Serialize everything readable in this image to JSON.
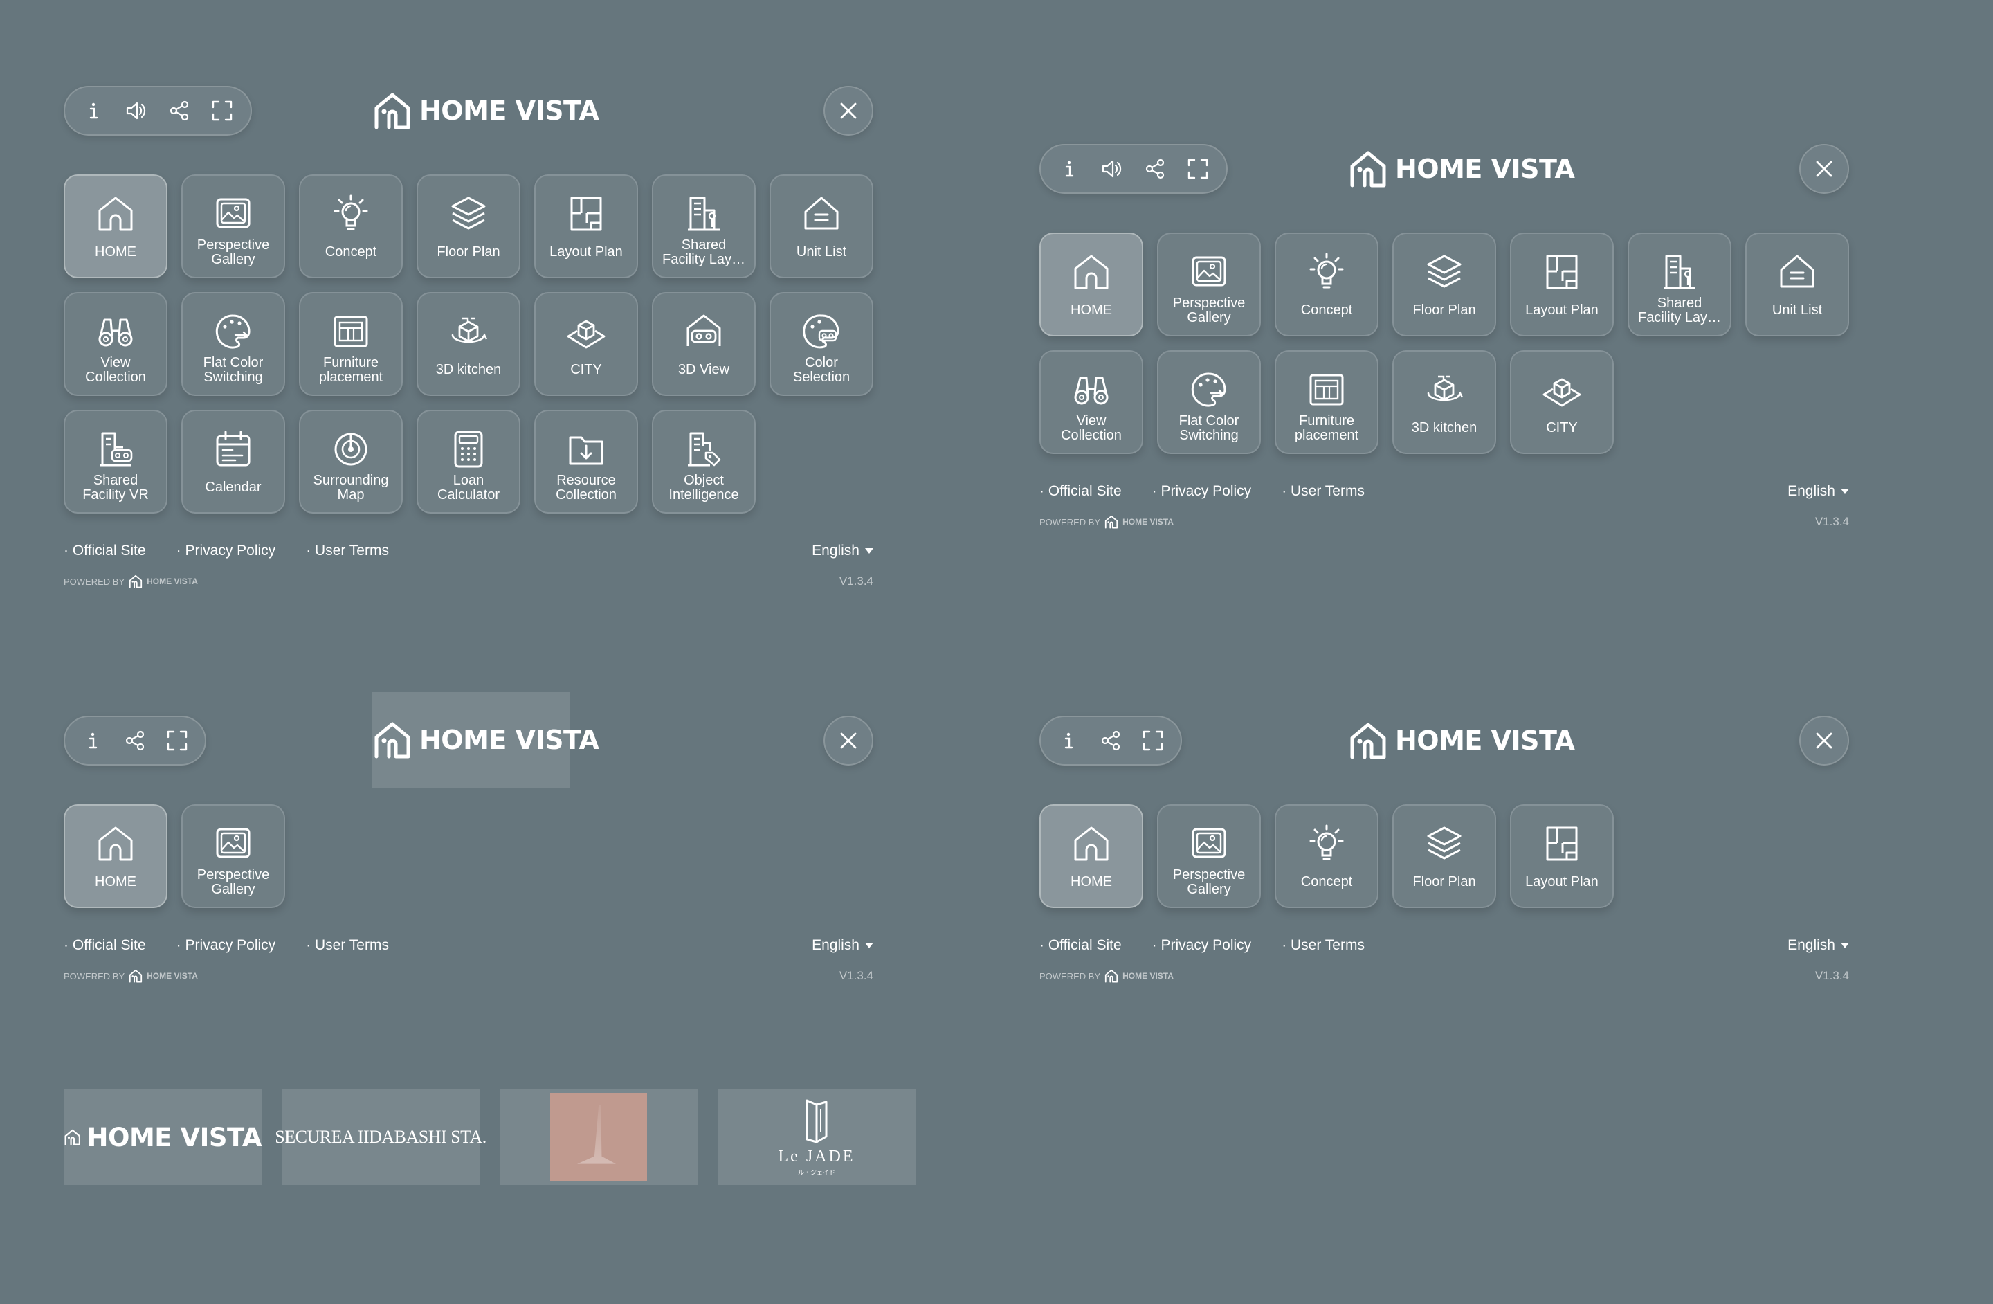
{
  "brand": {
    "name": "HOME VISTA"
  },
  "icons": {
    "info": "info-icon",
    "sound": "speaker-icon",
    "share": "share-icon",
    "fullscreen": "fullscreen-icon",
    "close": "close-icon"
  },
  "menu": {
    "home": "HOME",
    "perspective": [
      "Perspective",
      "Gallery"
    ],
    "concept": "Concept",
    "floor_plan": "Floor Plan",
    "layout_plan": "Layout Plan",
    "shared_facility": [
      "Shared",
      "Facility Lay…"
    ],
    "unit_list": "Unit List",
    "view_collection": [
      "View",
      "Collection"
    ],
    "flat_color": [
      "Flat Color",
      "Switching"
    ],
    "furniture": [
      "Furniture",
      "placement"
    ],
    "kitchen": "3D kitchen",
    "city": "CITY",
    "view3d": "3D View",
    "color_selection": [
      "Color",
      "Selection"
    ],
    "shared_vr": [
      "Shared",
      "Facility VR"
    ],
    "calendar": "Calendar",
    "surrounding": [
      "Surrounding",
      "Map"
    ],
    "loan": [
      "Loan",
      "Calculator"
    ],
    "resource": [
      "Resource",
      "Collection"
    ],
    "object": [
      "Object",
      "Intelligence"
    ]
  },
  "footer": {
    "official_site": "· Official Site",
    "privacy_policy": "· Privacy Policy",
    "user_terms": "· User Terms",
    "language": "English",
    "powered_by": "POWERED BY",
    "powered_brand": "HOME VISTA",
    "version": "V1.3.4"
  },
  "brand_cards": {
    "home_vista": "HOME VISTA",
    "securea": "SECUREA IIDABASHI STA.",
    "le_jade": "Le JADE",
    "le_jade_sub": "ル・ジェイド"
  },
  "colors": {
    "background": "#66767d",
    "tile_active": "rgba(255,255,255,0.24)",
    "text": "#ffffff",
    "photo_tile": "#c09a8f"
  }
}
